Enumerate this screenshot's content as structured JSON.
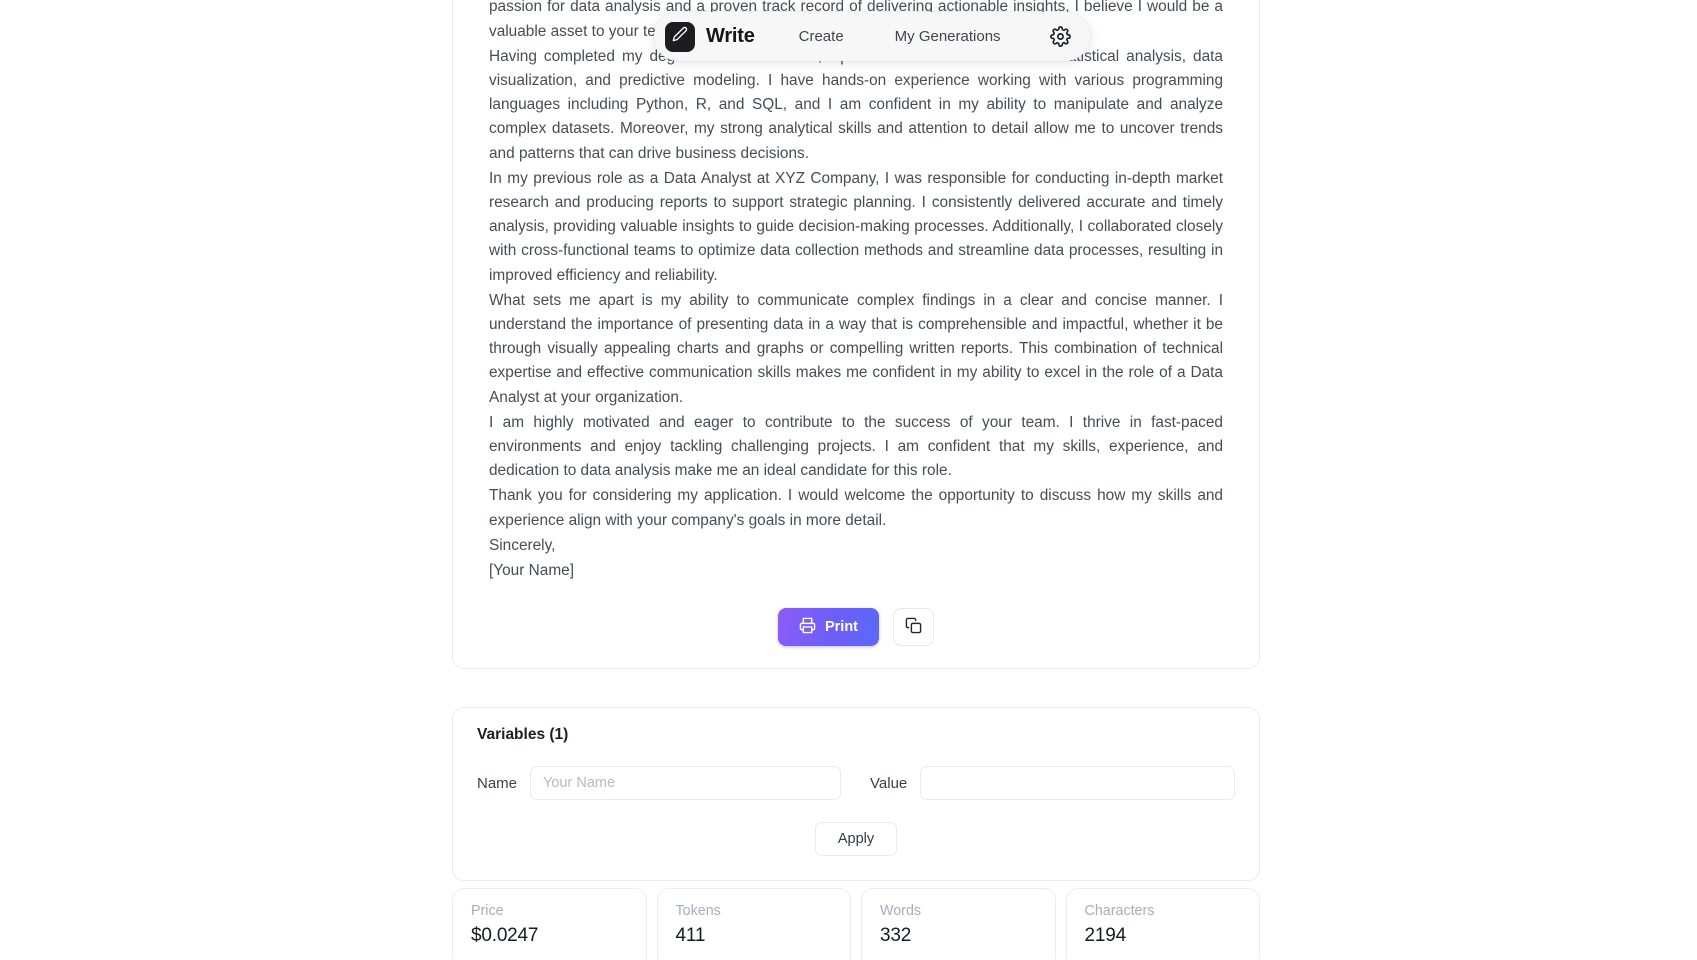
{
  "navbar": {
    "brand": "Write",
    "brand_icon": "pencil-icon",
    "links": [
      {
        "label": "Create"
      },
      {
        "label": "My Generations"
      }
    ],
    "settings_icon": "gear-icon"
  },
  "letter": {
    "paragraphs": [
      "I am writing to express my interest in the position of Data Analyst at your company. I was thrilled to come across the job listing and am excited about the opportunity to contribute to your goals. With a strong passion for data analysis and a proven track record of delivering actionable insights, I believe I would be a valuable asset to your team.",
      "Having completed my degree in Data Science, I possess a solid foundation in statistical analysis, data visualization, and predictive modeling. I have hands-on experience working with various programming languages including Python, R, and SQL, and I am confident in my ability to manipulate and analyze complex datasets. Moreover, my strong analytical skills and attention to detail allow me to uncover trends and patterns that can drive business decisions.",
      "In my previous role as a Data Analyst at XYZ Company, I was responsible for conducting in-depth market research and producing reports to support strategic planning. I consistently delivered accurate and timely analysis, providing valuable insights to guide decision-making processes. Additionally, I collaborated closely with cross-functional teams to optimize data collection methods and streamline data processes, resulting in improved efficiency and reliability.",
      "What sets me apart is my ability to communicate complex findings in a clear and concise manner. I understand the importance of presenting data in a way that is comprehensible and impactful, whether it be through visually appealing charts and graphs or compelling written reports. This combination of technical expertise and effective communication skills makes me confident in my ability to excel in the role of a Data Analyst at your organization.",
      "I am highly motivated and eager to contribute to the success of your team. I thrive in fast-paced environments and enjoy tackling challenging projects. I am confident that my skills, experience, and dedication to data analysis make me an ideal candidate for this role.",
      "Thank you for considering my application. I would welcome the opportunity to discuss how my skills and experience align with your company's goals in more detail."
    ],
    "signoff": "Sincerely,",
    "signature": "[Your Name]"
  },
  "actions": {
    "print_label": "Print",
    "print_icon": "printer-icon",
    "copy_icon": "copy-icon"
  },
  "variables": {
    "title": "Variables (1)",
    "name_label": "Name",
    "name_value": "",
    "name_placeholder": "Your Name",
    "value_label": "Value",
    "value_value": "",
    "value_placeholder": "",
    "apply_label": "Apply"
  },
  "stats": [
    {
      "label": "Price",
      "value": "$0.0247"
    },
    {
      "label": "Tokens",
      "value": "411"
    },
    {
      "label": "Words",
      "value": "332"
    },
    {
      "label": "Characters",
      "value": "2194"
    }
  ],
  "colors": {
    "accent_start": "#8b5cf6",
    "accent_end": "#5b68fa",
    "card_border": "#e9edf3",
    "body_text": "#474c55",
    "muted_label": "#a7aeba"
  }
}
